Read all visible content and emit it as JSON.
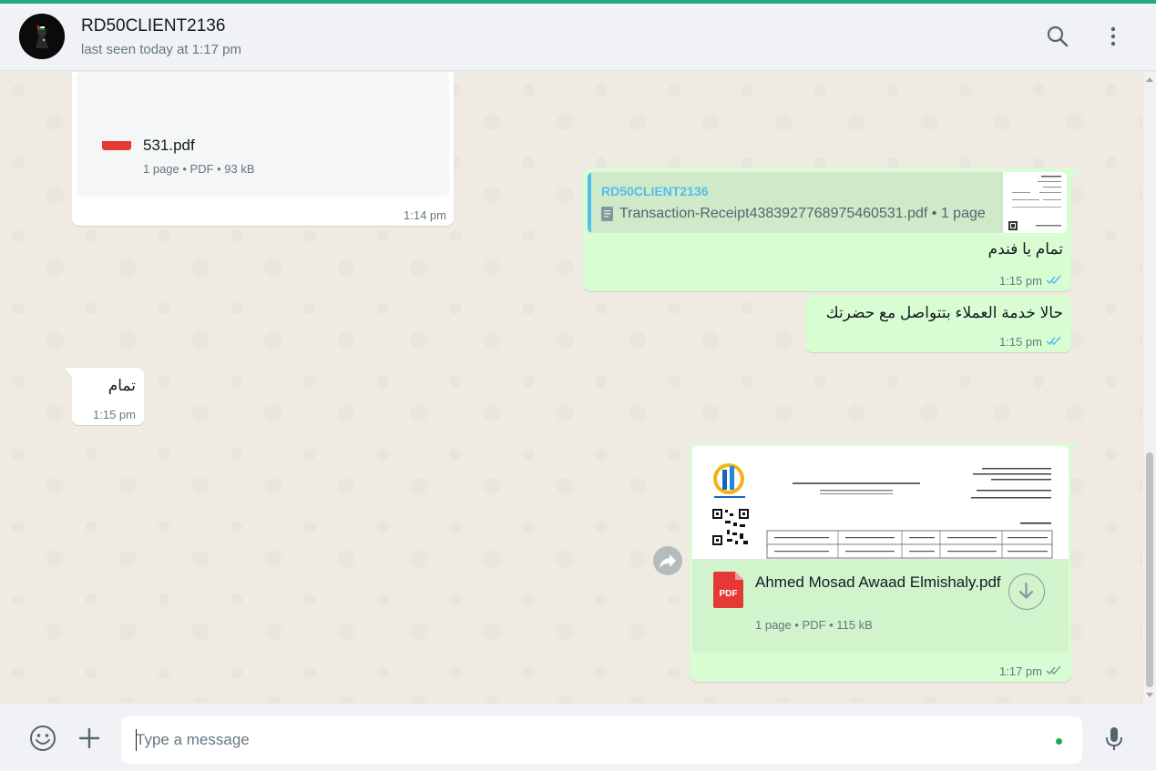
{
  "header": {
    "contact_name": "RD50CLIENT2136",
    "status": "last seen today at 1:17 pm",
    "avatar_icon": "profile-photo"
  },
  "colors": {
    "accent": "#25a884",
    "outgoing_bubble": "#d9fdd3",
    "incoming_bubble": "#ffffff",
    "read_ticks": "#53bdeb",
    "pdf_red": "#e53935"
  },
  "messages": [
    {
      "direction": "in",
      "type": "file",
      "file_name": "531.pdf",
      "file_meta": "1 page • PDF • 93 kB",
      "time": "1:14 pm"
    },
    {
      "direction": "out",
      "type": "reply",
      "quote_author": "RD50CLIENT2136",
      "quote_file": "Transaction-Receipt4383927768975460531.pdf • 1 page",
      "text": "تمام يا فندم",
      "time": "1:15 pm",
      "status": "read"
    },
    {
      "direction": "out",
      "type": "text",
      "text": "حالا خدمة العملاء بتتواصل مع حضرتك",
      "time": "1:15 pm",
      "status": "read"
    },
    {
      "direction": "in",
      "type": "text",
      "text": "تمام",
      "time": "1:15 pm"
    },
    {
      "direction": "out",
      "type": "document",
      "file_name": "Ahmed Mosad Awaad Elmishaly.pdf",
      "file_type_label": "PDF",
      "file_meta": "1 page • PDF • 115 kB",
      "time": "1:17 pm",
      "status": "delivered"
    }
  ],
  "composer": {
    "placeholder": "Type a message"
  }
}
